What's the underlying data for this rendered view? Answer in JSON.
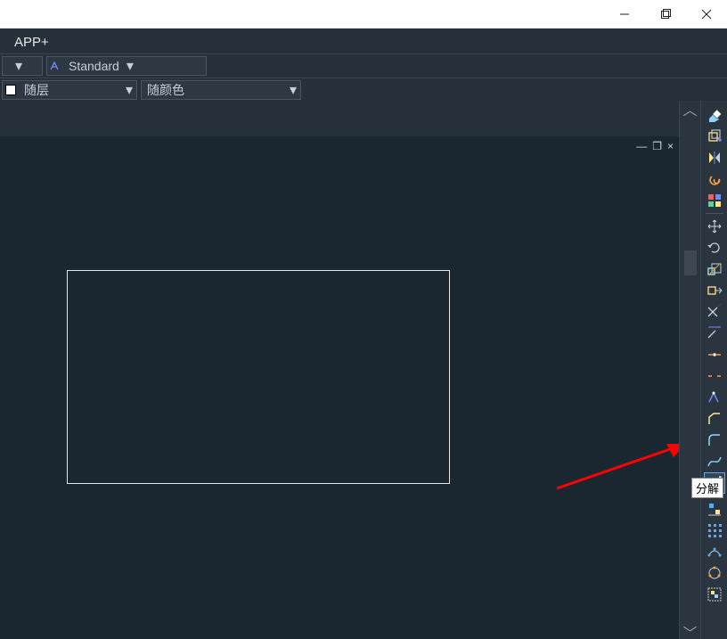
{
  "window": {
    "minimize_name": "minimize",
    "maximize_name": "maximize",
    "close_name": "close"
  },
  "apptab": {
    "label": "APP+"
  },
  "toolbars": {
    "style_dropdown": {
      "value": "Standard"
    },
    "layer_dropdown": {
      "value": "随层"
    },
    "color_dropdown": {
      "value": "随颜色"
    }
  },
  "viewport_controls": {
    "minimize": "—",
    "restore": "❐",
    "close": "×"
  },
  "tooltip": {
    "text": "分解"
  },
  "palette": [
    {
      "name": "eraser-icon",
      "primary": "#8fd3ff"
    },
    {
      "name": "copy-plus-icon",
      "primary": "#ffe58a"
    },
    {
      "name": "mirror-icon",
      "primary": "#ffe58a"
    },
    {
      "name": "spiral-icon",
      "primary": "#ff9d3b"
    },
    {
      "name": "color-grid-icon",
      "primary": "mixed"
    },
    {
      "name": "move-icon",
      "primary": "#c7d0d8"
    },
    {
      "name": "rotate-icon",
      "primary": "#c7d0d8"
    },
    {
      "name": "scale-icon",
      "primary": "#a8f0e8"
    },
    {
      "name": "stretch-icon",
      "primary": "#ffe58a"
    },
    {
      "name": "trim-icon",
      "primary": "#c7d0d8"
    },
    {
      "name": "extend-icon",
      "primary": "#c7d0d8"
    },
    {
      "name": "break-point-icon",
      "primary": "#ff9d3b"
    },
    {
      "name": "break-icon",
      "primary": "#ff9d3b"
    },
    {
      "name": "join-icon",
      "primary": "#6e8cff"
    },
    {
      "name": "chamfer-icon",
      "primary": "#ffe58a"
    },
    {
      "name": "fillet-icon",
      "primary": "#8fd3ff"
    },
    {
      "name": "blend-curves-icon",
      "primary": "#8fd3ff"
    },
    {
      "name": "explode-icon",
      "primary": "#ff9d3b",
      "highlight": true
    },
    {
      "name": "align-icon",
      "primary": "#5aa8ff"
    },
    {
      "name": "array-icon",
      "primary": "#5aa8ff"
    },
    {
      "name": "array-path-icon",
      "primary": "#5aa8ff"
    },
    {
      "name": "array-polar-icon",
      "primary": "#ff9d3b"
    },
    {
      "name": "group-icon",
      "primary": "#c7d0d8"
    }
  ]
}
